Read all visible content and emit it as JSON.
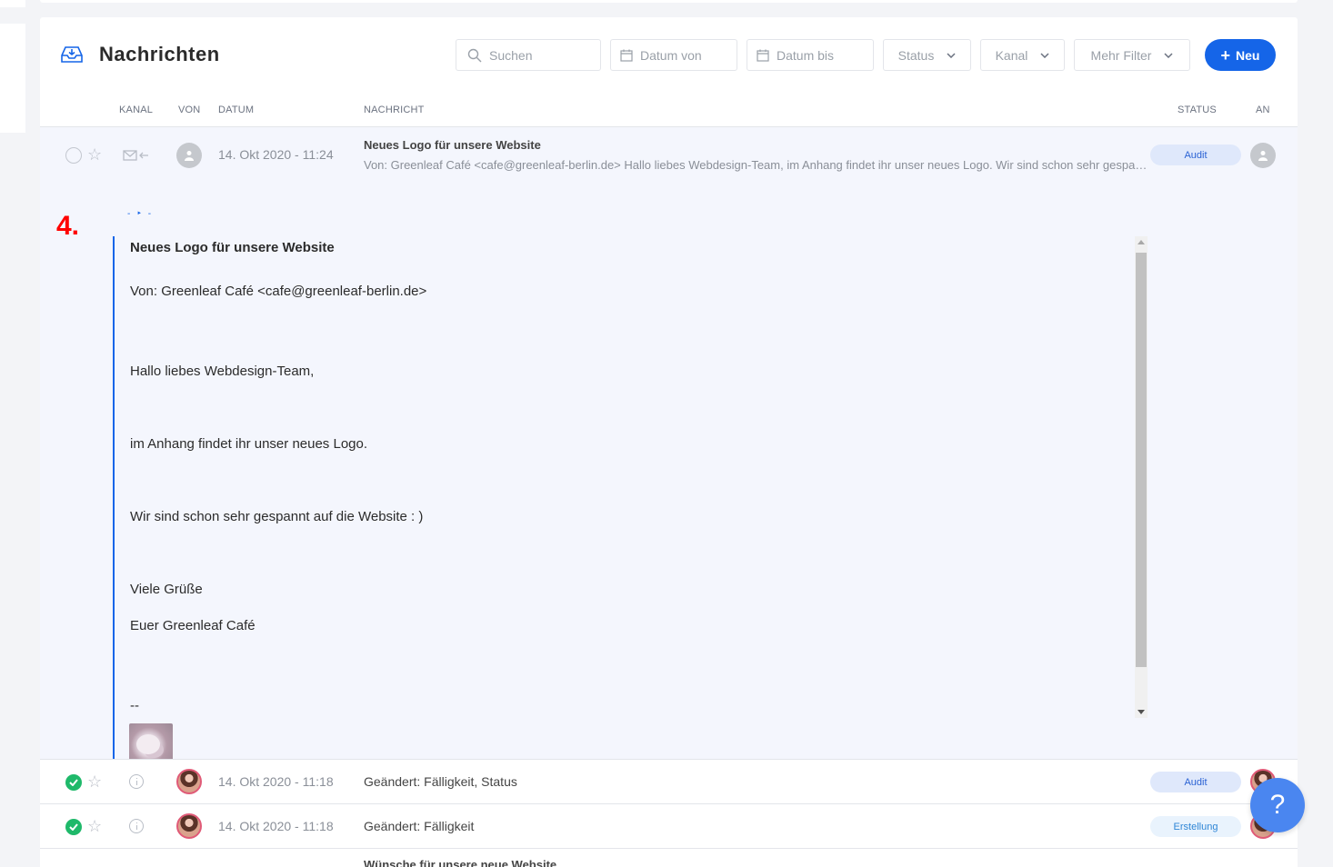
{
  "header": {
    "title": "Nachrichten",
    "search_placeholder": "Suchen",
    "date_from": "Datum von",
    "date_to": "Datum bis",
    "status_filter": "Status",
    "kanal_filter": "Kanal",
    "more_filters": "Mehr Filter",
    "new_button": "Neu"
  },
  "columns": {
    "kanal": "KANAL",
    "von": "VON",
    "datum": "DATUM",
    "nachricht": "NACHRICHT",
    "status": "STATUS",
    "an": "AN"
  },
  "expanded_message": {
    "date": "14. Okt 2020 - 11:24",
    "subject": "Neues Logo für unsere Website",
    "preview": "Von: Greenleaf Café <cafe@greenleaf-berlin.de> Hallo liebes Webdesign-Team,  im Anhang findet ihr unser neues Logo.  Wir sind schon sehr gespannt auf die Website : )",
    "status": "Audit",
    "step_marker": "4.",
    "mini_controls": "- ‣ -",
    "body": {
      "subject": "Neues Logo für unsere Website",
      "from": "Von: Greenleaf Café <cafe@greenleaf-berlin.de>",
      "greeting": "Hallo liebes Webdesign-Team,",
      "line1": "im Anhang findet ihr unser neues Logo.",
      "line2": "Wir sind schon sehr gespannt auf die Website : )",
      "closing": "Viele Grüße",
      "signature": "Euer Greenleaf Café",
      "separator": "--"
    }
  },
  "rows": [
    {
      "date": "14. Okt 2020 - 11:18",
      "text": "Geändert: Fälligkeit, Status",
      "status": "Audit"
    },
    {
      "date": "14. Okt 2020 - 11:18",
      "text": "Geändert: Fälligkeit",
      "status": "Erstellung"
    }
  ],
  "last_row": {
    "subject": "Wünsche für unsere neue Website"
  },
  "help": {
    "label": "?"
  },
  "colors": {
    "accent": "#1565e8",
    "success": "#1fb96a",
    "marker": "#ff0000"
  },
  "icons": [
    "inbox-icon",
    "search-icon",
    "calendar-icon",
    "chevron-down-icon",
    "star-icon",
    "mail-incoming-icon",
    "user-icon",
    "check-icon",
    "info-icon"
  ]
}
